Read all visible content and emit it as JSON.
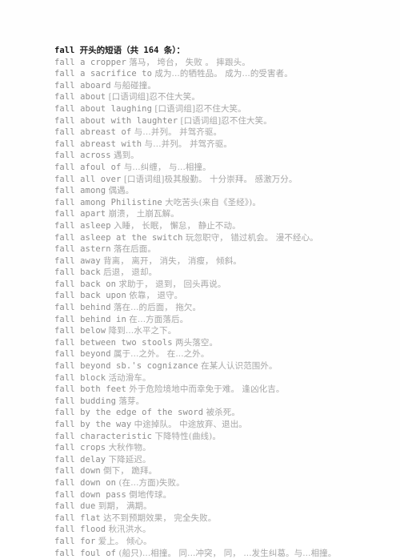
{
  "document": {
    "title": "fall 开头的短语（共 164 条）：",
    "entries": [
      {
        "term": "fall a cropper",
        "gloss": "落马， 垮台， 失败 。 摔跟头。"
      },
      {
        "term": "fall a sacrifice to",
        "gloss": "成为...的牺牲品。 成为...的受害者。"
      },
      {
        "term": "fall aboard",
        "gloss": "与船碰撞。"
      },
      {
        "term": "fall about",
        "gloss": "[口语词组]忍不住大笑。"
      },
      {
        "term": "fall about laughing",
        "gloss": "[口语词组]忍不住大笑。"
      },
      {
        "term": "fall about with laughter",
        "gloss": "[口语词组]忍不住大笑。"
      },
      {
        "term": "fall abreast of",
        "gloss": "与…并列。 并驾齐驱。"
      },
      {
        "term": "fall abreast with",
        "gloss": "与…并列。 并驾齐驱。"
      },
      {
        "term": "fall across",
        "gloss": "遇到。"
      },
      {
        "term": "fall afoul of",
        "gloss": "与...纠缠， 与...相撞。"
      },
      {
        "term": "fall all over",
        "gloss": "[口语词组]极其殷勤。 十分崇拜。 感激万分。"
      },
      {
        "term": "fall among",
        "gloss": "偶遇。"
      },
      {
        "term": "fall among Philistine",
        "gloss": "大吃苦头(来自《圣经》)。"
      },
      {
        "term": "fall apart",
        "gloss": "崩溃， 土崩瓦解。"
      },
      {
        "term": "fall asleep",
        "gloss": "入睡， 长眠， 懈怠， 静止不动。"
      },
      {
        "term": "fall asleep at the switch",
        "gloss": "玩忽职守， 错过机会。 漫不经心。"
      },
      {
        "term": "fall astern",
        "gloss": "落在后面。"
      },
      {
        "term": "fall away",
        "gloss": "背离， 离开， 消失， 消瘦， 倾斜。"
      },
      {
        "term": "fall back",
        "gloss": "后退， 退却。"
      },
      {
        "term": "fall back on",
        "gloss": "求助于， 退到， 回头再说。"
      },
      {
        "term": "fall back upon",
        "gloss": "依靠， 退守。"
      },
      {
        "term": "fall behind",
        "gloss": "落在...的后面， 拖欠。"
      },
      {
        "term": "fall behind in",
        "gloss": "在...方面落后。"
      },
      {
        "term": "fall below",
        "gloss": "降到…水平之下。"
      },
      {
        "term": "fall between two stools",
        "gloss": "两头落空。"
      },
      {
        "term": "fall beyond",
        "gloss": "属于...之外。 在...之外。"
      },
      {
        "term": "fall beyond sb.'s cognizance",
        "gloss": "在某人认识范围外。"
      },
      {
        "term": "fall block",
        "gloss": "活动滑车。"
      },
      {
        "term": "fall both feet",
        "gloss": "外于危险境地中而幸免于难。 逢凶化吉。"
      },
      {
        "term": "fall budding",
        "gloss": "落芽。"
      },
      {
        "term": "fall by the edge of the sword",
        "gloss": "被杀死。"
      },
      {
        "term": "fall by the way",
        "gloss": "中途掉队。 中途放弃、退出。"
      },
      {
        "term": "fall characteristic",
        "gloss": "下降特性(曲线)。"
      },
      {
        "term": "fall crops",
        "gloss": "大秋作物。"
      },
      {
        "term": "fall delay",
        "gloss": "下降延迟。"
      },
      {
        "term": "fall down",
        "gloss": "倒下， 跪拜。"
      },
      {
        "term": "fall down on",
        "gloss": "(在...方面)失败。"
      },
      {
        "term": "fall down pass",
        "gloss": "倒地传球。"
      },
      {
        "term": "fall due",
        "gloss": "到期， 满期。"
      },
      {
        "term": "fall flat",
        "gloss": "达不到预期效果， 完全失败。"
      },
      {
        "term": "fall flood",
        "gloss": "秋汛洪水。"
      },
      {
        "term": "fall for",
        "gloss": "爱上。 倾心。"
      },
      {
        "term": "fall foul of",
        "gloss": "(船只)...相撞。 同...冲突， 同， ...发生纠葛。与...相撞。"
      }
    ]
  },
  "colors": {
    "page_background": "#fefefe",
    "title_text": "#1a1a1a",
    "term_text": "#8e8e8e",
    "gloss_text": "#a6a6a6"
  }
}
